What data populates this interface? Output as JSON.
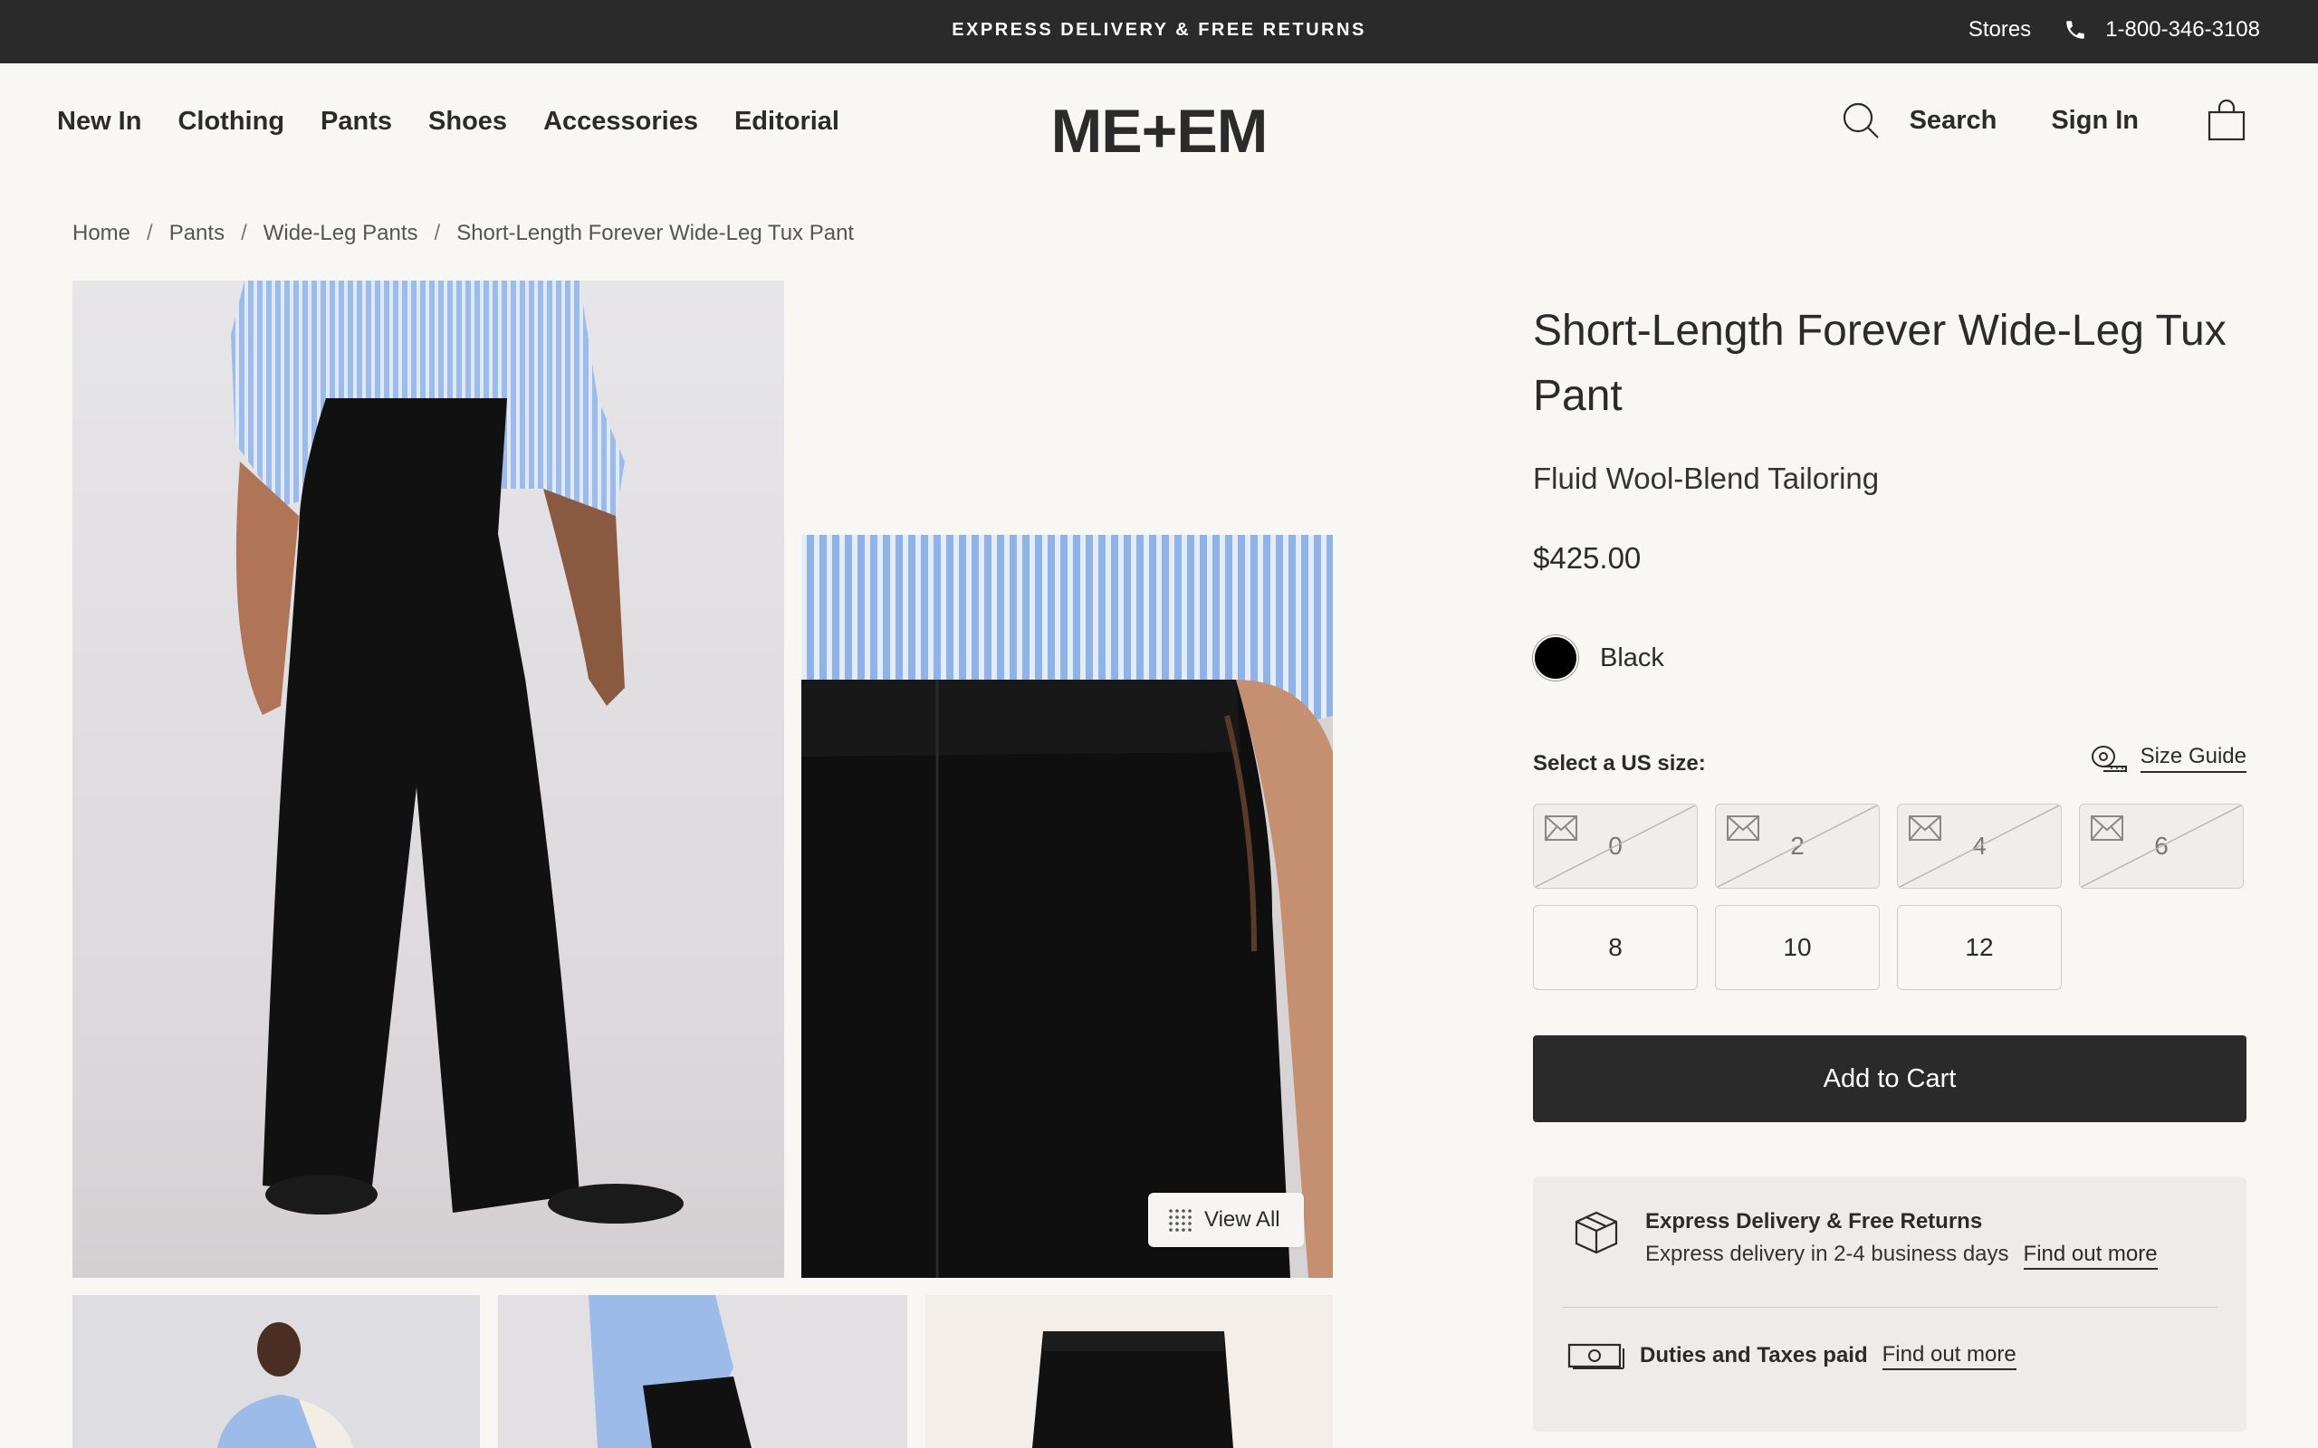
{
  "topbar": {
    "promo": "EXPRESS DELIVERY & FREE RETURNS",
    "stores": "Stores",
    "phone": "1-800-346-3108"
  },
  "header": {
    "nav": [
      "New In",
      "Clothing",
      "Pants",
      "Shoes",
      "Accessories",
      "Editorial"
    ],
    "logo": "ME+EM",
    "search": "Search",
    "sign_in": "Sign In"
  },
  "breadcrumb": [
    "Home",
    "Pants",
    "Wide-Leg Pants",
    "Short-Length Forever Wide-Leg Tux Pant"
  ],
  "gallery": {
    "view_all": "View All"
  },
  "product": {
    "title": "Short-Length Forever Wide-Leg Tux Pant",
    "subtitle": "Fluid Wool-Blend Tailoring",
    "price": "$425.00",
    "color": "Black",
    "color_hex": "#000000",
    "size_label": "Select a US size:",
    "size_guide": "Size Guide",
    "sizes": [
      {
        "label": "0",
        "available": false
      },
      {
        "label": "2",
        "available": false
      },
      {
        "label": "4",
        "available": false
      },
      {
        "label": "6",
        "available": false
      },
      {
        "label": "8",
        "available": true
      },
      {
        "label": "10",
        "available": true
      },
      {
        "label": "12",
        "available": true
      }
    ],
    "add_to_cart": "Add to Cart"
  },
  "delivery": {
    "heading": "Express Delivery & Free Returns",
    "detail": "Express delivery in 2-4 business days",
    "find_out_more": "Find out more",
    "duties": "Duties and Taxes paid",
    "duties_link": "Find out more"
  },
  "colors": {
    "topbar": "#2a2a2a",
    "background": "#f8f7f4",
    "button": "#2a2a2a",
    "shirt_blue": "#8fb3e6"
  }
}
